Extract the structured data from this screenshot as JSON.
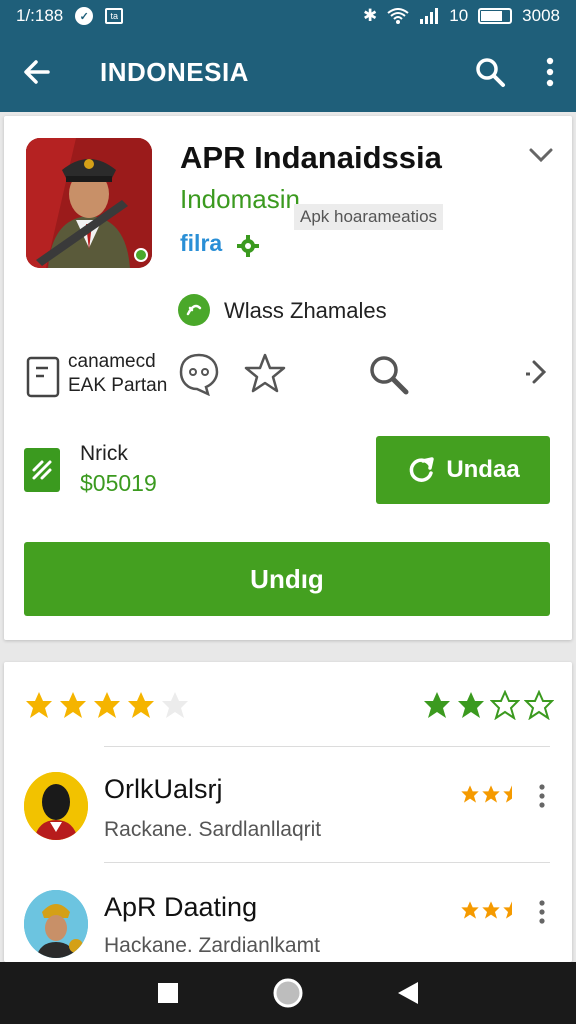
{
  "status_bar": {
    "time": "1/:188",
    "right_text": "3008"
  },
  "app_bar": {
    "title": "INDONESIA"
  },
  "app": {
    "name": "APR Indanaidssia",
    "developer": "Indomasin",
    "apk_tag": "Apk hoarameatios",
    "category": "filra",
    "publisher": "Wlass Zhamales",
    "meta_line1": "canamecd",
    "meta_line2": "EAK Partan"
  },
  "price": {
    "label": "Nrick",
    "value": "$05019"
  },
  "buttons": {
    "update_small": "Undaa",
    "update_big": "Undıg"
  },
  "ratings": {
    "left_stars": 4,
    "right_stars": 2,
    "max": 5
  },
  "reviews": [
    {
      "name": "OrlkUalsrj",
      "text": "Rackane. Sardlanllaqrit",
      "stars": 2.5
    },
    {
      "name": "ApR Daating",
      "text": "Hackane. Zardianlkamt",
      "stars": 2.5
    }
  ],
  "colors": {
    "app_bar": "#1f5f7a",
    "accent_green": "#44a020",
    "star_gold": "#f5b400",
    "star_green": "#3b9a1f",
    "link_blue": "#2a8fd6"
  }
}
